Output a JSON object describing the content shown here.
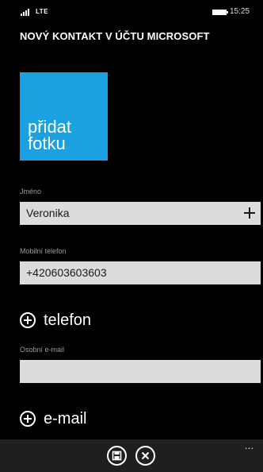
{
  "status_bar": {
    "network": "LTE",
    "time": "15:25"
  },
  "page": {
    "title": "NOVÝ KONTAKT V ÚČTU MICROSOFT"
  },
  "photo": {
    "label": "přidat fotku",
    "color": "#1ba1e2"
  },
  "fields": {
    "name": {
      "label": "Jméno",
      "value": "Veronika"
    },
    "mobile": {
      "label": "Mobilní telefon",
      "value": "+420603603603"
    },
    "email": {
      "label": "Osobní e-mail",
      "value": ""
    }
  },
  "actions": {
    "add_phone": "telefon",
    "add_email": "e-mail"
  },
  "app_bar": {
    "buttons": [
      {
        "name": "save",
        "icon": "save-icon"
      },
      {
        "name": "cancel",
        "icon": "close-icon"
      }
    ],
    "more": "..."
  }
}
